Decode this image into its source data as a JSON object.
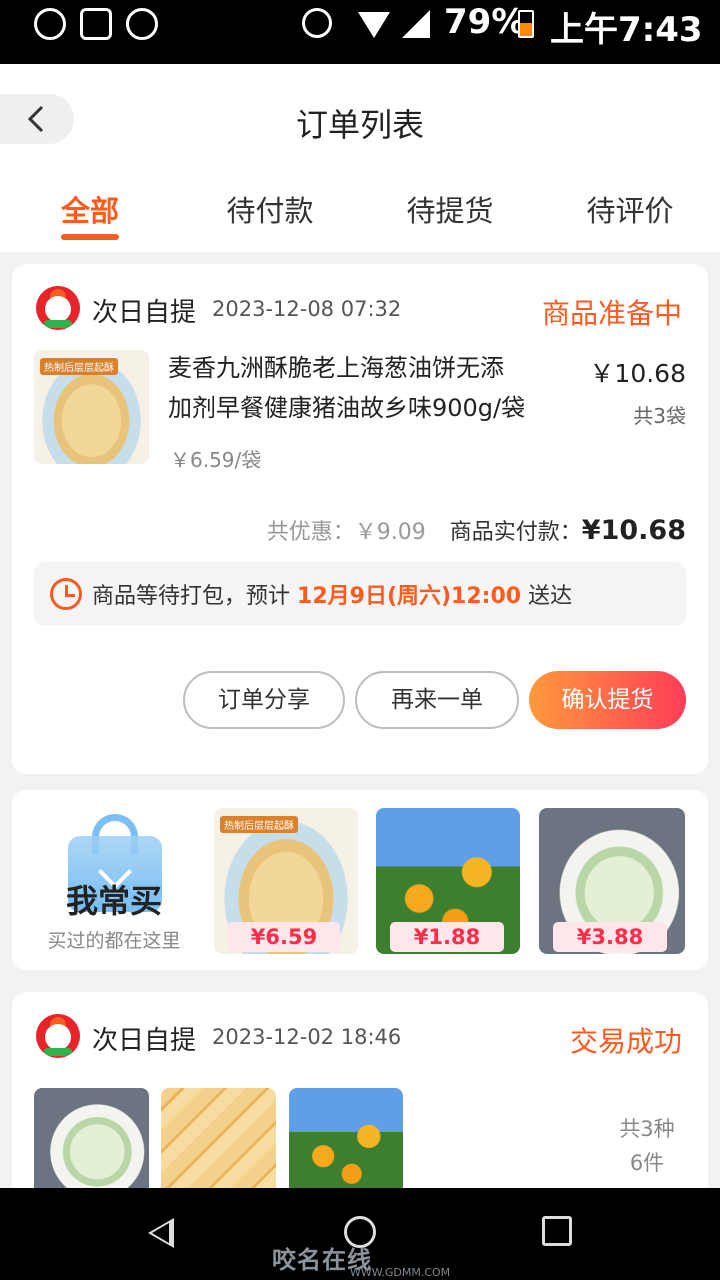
{
  "status_bar": {
    "battery": "79%",
    "time": "上午7:43",
    "icons": [
      "no-call-icon",
      "pulse-icon",
      "phone-icon",
      "alarm-icon",
      "wifi-icon",
      "signal-icon",
      "battery-charging-icon"
    ]
  },
  "header": {
    "title": "订单列表",
    "back_icon": "chevron-left-icon"
  },
  "tabs": [
    {
      "label": "全部",
      "active": true
    },
    {
      "label": "待付款",
      "active": false
    },
    {
      "label": "待提货",
      "active": false
    },
    {
      "label": "待评价",
      "active": false
    }
  ],
  "order1": {
    "store": "次日自提",
    "time": "2023-12-08 07:32",
    "status": "商品准备中",
    "item": {
      "thumb_tag": "热制后层层起酥",
      "name_line1": "麦香九洲酥脆老上海葱油饼无添",
      "name_line2": "加剂早餐健康猪油故乡味900g/袋",
      "unit_price": "￥6.59/袋",
      "price": "￥10.68",
      "qty": "共3袋"
    },
    "discount_label": "共优惠：",
    "discount_value": "￥9.09",
    "paid_label": "商品实付款：",
    "paid_value": "¥10.68",
    "notice_prefix": "商品等待打包，预计",
    "notice_time": "12月9日(周六)12:00",
    "notice_suffix": "送达",
    "buttons": {
      "share": "订单分享",
      "reorder": "再来一单",
      "confirm": "确认提货"
    }
  },
  "frequent": {
    "title": "我常买",
    "subtitle": "买过的都在这里",
    "items": [
      {
        "price": "¥6.59",
        "tag": "热制后层层起酥"
      },
      {
        "price": "¥1.88"
      },
      {
        "price": "¥3.88"
      }
    ]
  },
  "order2": {
    "store": "次日自提",
    "time": "2023-12-02 18:46",
    "status": "交易成功",
    "count_kinds": "共3种",
    "count_items": "6件"
  },
  "watermark": {
    "text": "咬名在线",
    "url": "WWW.GDMM.COM"
  },
  "colors": {
    "accent": "#ff5a1f",
    "price_red": "#ff2c4a",
    "brand_red": "#e8232a"
  }
}
